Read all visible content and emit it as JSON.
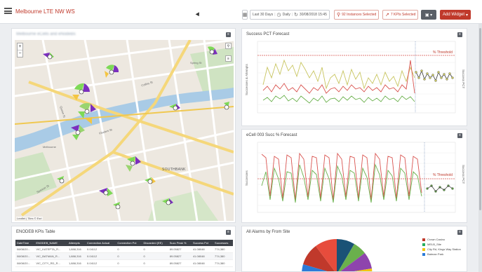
{
  "header": {
    "title": "Melbourne LTE NW WS",
    "date_range": "Last 30 Days",
    "granularity": "Daily",
    "refresh_time": "30/08/2018 15:45",
    "instances": "92 Instances Selected",
    "kpis": "7 KPIs Selected",
    "add_widget": "Add Widget"
  },
  "map_panel": {
    "title": "Melbourne eCells and eNodeBs",
    "attribution": "Leaflet | Tiles © Esri",
    "labels": [
      "SOUTHBANK",
      "Flinders St",
      "Collins St",
      "Queen St",
      "Spencer St",
      "Spring St",
      "Melbourne"
    ]
  },
  "chart1": {
    "title": "Success PCT Forecast",
    "threshold_label": "% Threshold",
    "ylabel_left": "Successes & Attempts",
    "ylabel_right": "Success PCT"
  },
  "chart2": {
    "title": "eCell 003 Succ % Forecast",
    "threshold_label": "% Threshold",
    "ylabel_left": "Successes",
    "ylabel_right": "Success PCT"
  },
  "table_panel": {
    "title": "ENODEB KPIs Table",
    "columns": [
      "DateTime",
      "ENODEB_NAME",
      "Attempts",
      "Connection Actual",
      "Connection Pct",
      "Discarded (EE)",
      "Succ Peak %",
      "Success Pct",
      "Successes"
    ],
    "rows": [
      [
        "08/08/20...",
        "VIC_KATEPTA_R...",
        "1,888,316",
        "0.04112",
        "0",
        "0",
        "89.05827",
        "41.08048",
        "774,380"
      ],
      [
        "08/08/20...",
        "VIC_BATMAN_R...",
        "1,888,316",
        "0.04112",
        "0",
        "0",
        "89.05827",
        "41.08048",
        "774,380"
      ],
      [
        "08/08/20...",
        "VIC_CITY_RD_R...",
        "1,888,316",
        "0.04112",
        "0",
        "0",
        "89.05827",
        "41.08048",
        "774,380"
      ]
    ]
  },
  "alarms_panel": {
    "title": "All Alarms by From Site",
    "legend": [
      {
        "name": "Crown Casino",
        "color": "#c0392b"
      },
      {
        "name": "MELB_Site",
        "color": "#27ae60"
      },
      {
        "name": "City Rd, Kings Way Station",
        "color": "#f1c40f"
      },
      {
        "name": "Batman Park",
        "color": "#2c7bd8"
      }
    ]
  },
  "colors": {
    "accent": "#c0392b",
    "green": "#6ab04c",
    "yellow": "#c8c560",
    "threshold": "#d9534f"
  }
}
